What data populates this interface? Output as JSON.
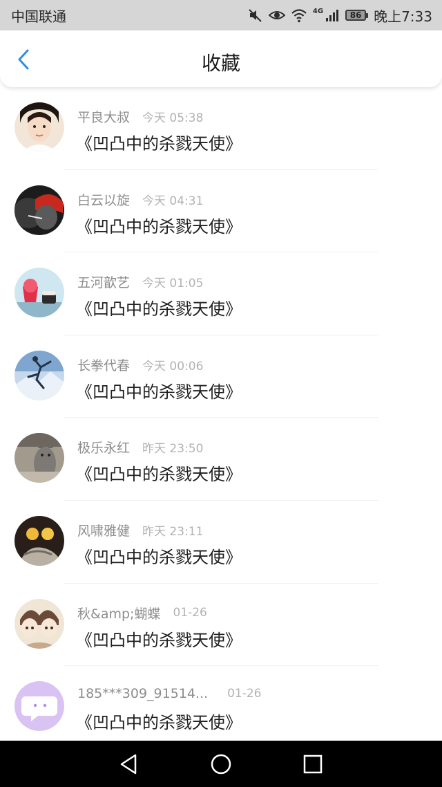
{
  "status_bar": {
    "carrier": "中国联通",
    "network": "4G",
    "battery": "86",
    "time": "晚上7:33"
  },
  "header": {
    "title": "收藏",
    "back_icon": "chevron-left-icon"
  },
  "favorites": [
    {
      "user": "平良大叔",
      "time": "今天 05:38",
      "title": "《凹凸中的杀戮天使》"
    },
    {
      "user": "白云以旋",
      "time": "今天 04:31",
      "title": "《凹凸中的杀戮天使》"
    },
    {
      "user": "五河歆艺",
      "time": "今天 01:05",
      "title": "《凹凸中的杀戮天使》"
    },
    {
      "user": "长拳代春",
      "time": "今天 00:06",
      "title": "《凹凸中的杀戮天使》"
    },
    {
      "user": "极乐永红",
      "time": "昨天 23:50",
      "title": "《凹凸中的杀戮天使》"
    },
    {
      "user": "风啸雅健",
      "time": "昨天 23:11",
      "title": "《凹凸中的杀戮天使》"
    },
    {
      "user": "秋&amp;蝴蝶",
      "time": "01-26",
      "title": "《凹凸中的杀戮天使》"
    },
    {
      "user": "185***309_91514...",
      "time": "01-26",
      "title": "《凹凸中的杀戮天使》"
    }
  ],
  "colors": {
    "accent": "#2f8de4",
    "status_bar_bg": "#d6d6d6",
    "nav_bar_bg": "#000000"
  },
  "nav_bar": {
    "back_icon": "triangle-back-icon",
    "home_icon": "circle-home-icon",
    "recents_icon": "square-recents-icon"
  }
}
